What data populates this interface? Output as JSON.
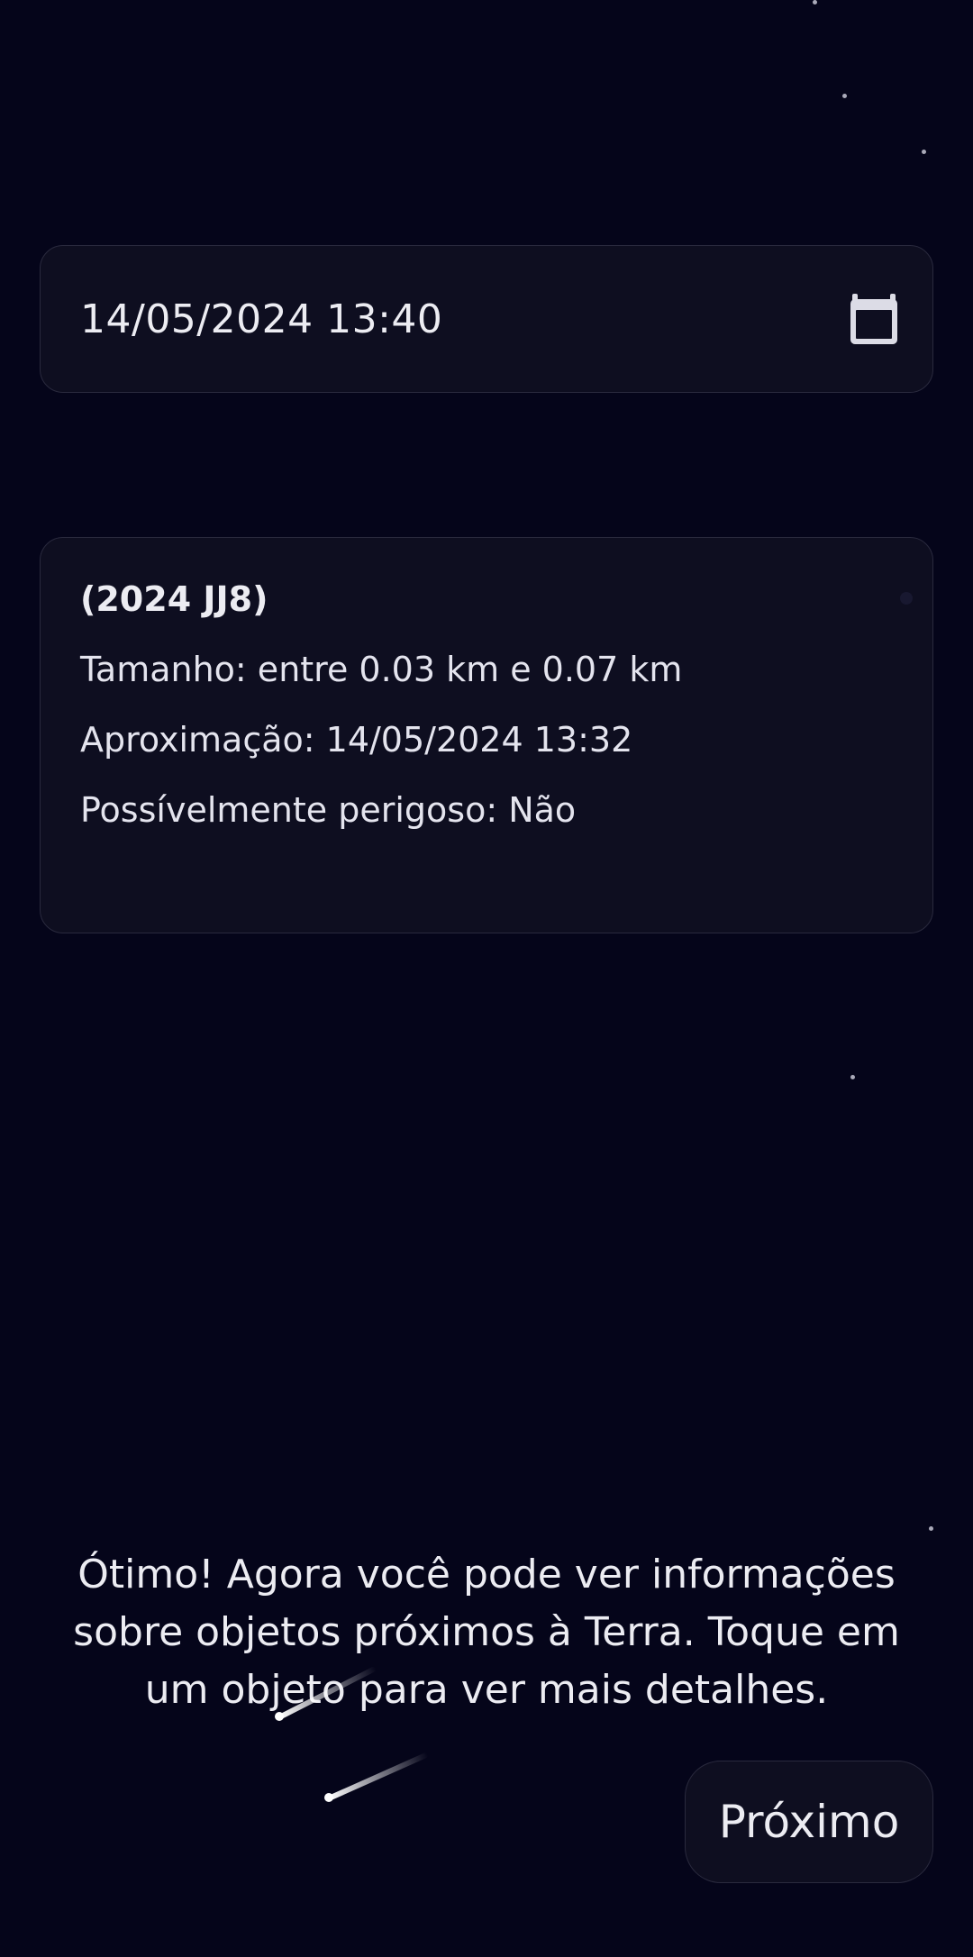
{
  "date_field": {
    "value": "14/05/2024 13:40",
    "icon": "calendar-icon"
  },
  "neo_card": {
    "name": "(2024 JJ8)",
    "size_line": "Tamanho: entre 0.03 km e 0.07 km",
    "approach_line": "Aproximação: 14/05/2024 13:32",
    "hazard_line": "Possívelmente perigoso: Não"
  },
  "tutorial": {
    "message": "Ótimo! Agora você pode ver informações sobre objetos próximos à Terra. Toque em um objeto para ver mais detalhes."
  },
  "buttons": {
    "next_label": "Próximo"
  },
  "colors": {
    "background": "#05051a",
    "surface": "#0e0e20",
    "border": "#2a2a3e",
    "text": "#ececf2"
  }
}
